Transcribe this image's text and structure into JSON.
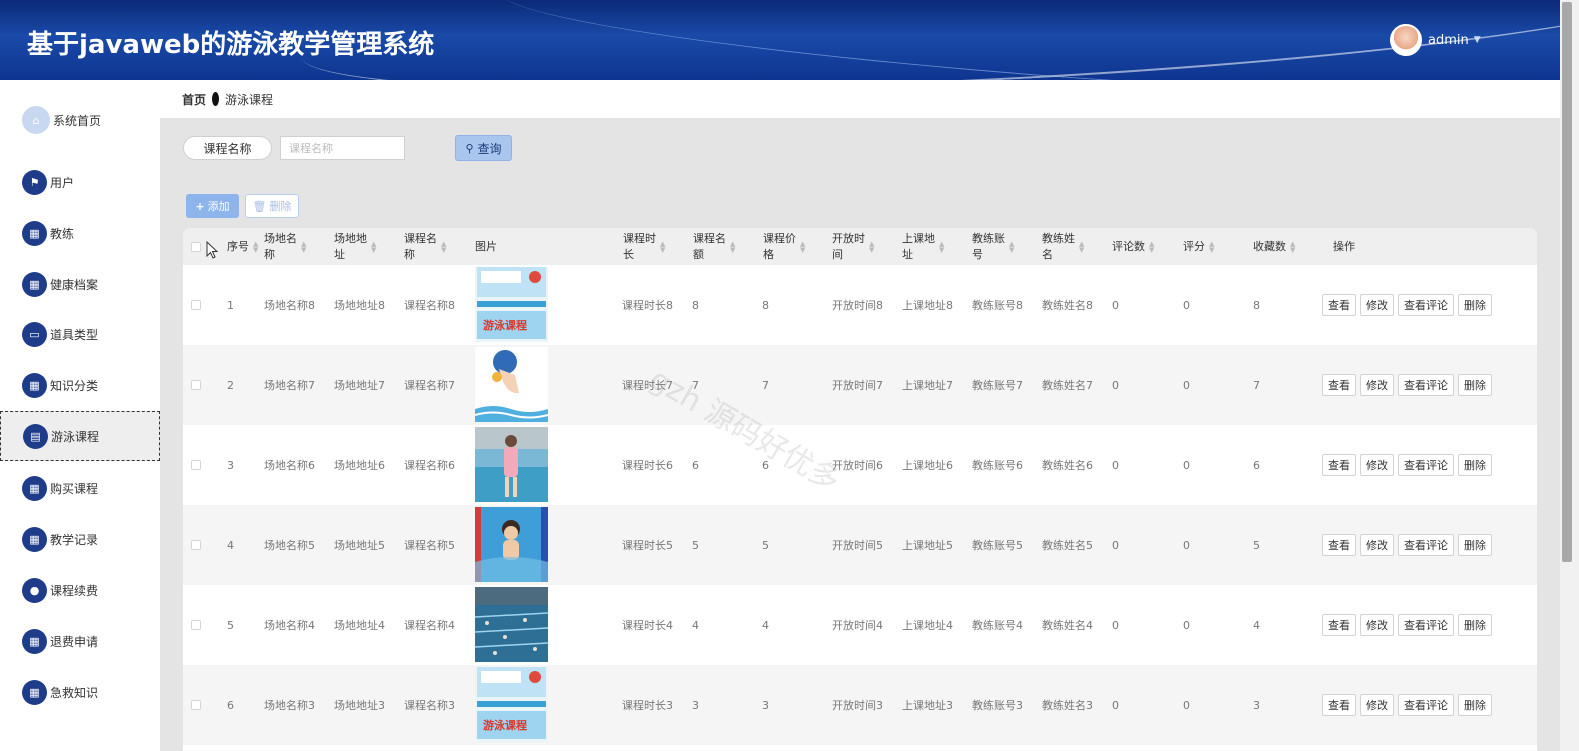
{
  "header": {
    "title": "基于javaweb的游泳教学管理系统",
    "username": "admin"
  },
  "breadcrumb": {
    "home": "首页",
    "current": "游泳课程"
  },
  "sidebar": {
    "items": [
      {
        "label": "系统首页",
        "icon": "home-icon"
      },
      {
        "label": "用户",
        "icon": "flag-icon"
      },
      {
        "label": "教练",
        "icon": "grid-icon"
      },
      {
        "label": "健康档案",
        "icon": "grid-icon"
      },
      {
        "label": "道具类型",
        "icon": "monitor-icon"
      },
      {
        "label": "知识分类",
        "icon": "grid-icon"
      },
      {
        "label": "游泳课程",
        "icon": "clipboard-icon",
        "active": true
      },
      {
        "label": "购买课程",
        "icon": "grid-icon"
      },
      {
        "label": "教学记录",
        "icon": "grid-icon"
      },
      {
        "label": "课程续费",
        "icon": "user-icon"
      },
      {
        "label": "退费申请",
        "icon": "grid-icon"
      },
      {
        "label": "急救知识",
        "icon": "grid-icon"
      }
    ]
  },
  "search": {
    "label": "课程名称",
    "placeholder": "课程名称",
    "value": "",
    "query_label": "查询"
  },
  "toolbar": {
    "add_label": "添加",
    "delete_label": "删除"
  },
  "table": {
    "columns": {
      "index": "序号",
      "venue_name": "场地名\n称",
      "venue_address": "场地地\n址",
      "course_name": "课程名\n称",
      "image": "图片",
      "duration": "课程时\n长",
      "quota": "课程名\n额",
      "price": "课程价\n格",
      "open_time": "开放时\n间",
      "class_address": "上课地\n址",
      "coach_account": "教练账\n号",
      "coach_name": "教练姓\n名",
      "comments": "评论数",
      "rating": "评分",
      "favorites": "收藏数",
      "actions": "操作"
    },
    "action_labels": {
      "view": "查看",
      "edit": "修改",
      "view_comments": "查看评论",
      "delete": "删除"
    },
    "rows": [
      {
        "index": "1",
        "venue_name": "场地名称8",
        "venue_address": "场地地址8",
        "course_name": "课程名称8",
        "image": "swim-poster",
        "duration": "课程时长8",
        "quota": "8",
        "price": "8",
        "open_time": "开放时间8",
        "class_address": "上课地址8",
        "coach_account": "教练账号8",
        "coach_name": "教练姓名8",
        "comments": "0",
        "rating": "0",
        "favorites": "8"
      },
      {
        "index": "2",
        "venue_name": "场地名称7",
        "venue_address": "场地地址7",
        "course_name": "课程名称7",
        "image": "swimmer-cartoon",
        "duration": "课程时长7",
        "quota": "7",
        "price": "7",
        "open_time": "开放时间7",
        "class_address": "上课地址7",
        "coach_account": "教练账号7",
        "coach_name": "教练姓名7",
        "comments": "0",
        "rating": "0",
        "favorites": "7"
      },
      {
        "index": "3",
        "venue_name": "场地名称6",
        "venue_address": "场地地址6",
        "course_name": "课程名称6",
        "image": "girl-poolside",
        "duration": "课程时长6",
        "quota": "6",
        "price": "6",
        "open_time": "开放时间6",
        "class_address": "上课地址6",
        "coach_account": "教练账号6",
        "coach_name": "教练姓名6",
        "comments": "0",
        "rating": "0",
        "favorites": "6"
      },
      {
        "index": "4",
        "venue_name": "场地名称5",
        "venue_address": "场地地址5",
        "course_name": "课程名称5",
        "image": "boy-in-pool",
        "duration": "课程时长5",
        "quota": "5",
        "price": "5",
        "open_time": "开放时间5",
        "class_address": "上课地址5",
        "coach_account": "教练账号5",
        "coach_name": "教练姓名5",
        "comments": "0",
        "rating": "0",
        "favorites": "5"
      },
      {
        "index": "5",
        "venue_name": "场地名称4",
        "venue_address": "场地地址4",
        "course_name": "课程名称4",
        "image": "pool-lanes",
        "duration": "课程时长4",
        "quota": "4",
        "price": "4",
        "open_time": "开放时间4",
        "class_address": "上课地址4",
        "coach_account": "教练账号4",
        "coach_name": "教练姓名4",
        "comments": "0",
        "rating": "0",
        "favorites": "4"
      },
      {
        "index": "6",
        "venue_name": "场地名称3",
        "venue_address": "场地地址3",
        "course_name": "课程名称3",
        "image": "swim-poster",
        "duration": "课程时长3",
        "quota": "3",
        "price": "3",
        "open_time": "开放时间3",
        "class_address": "上课地址3",
        "coach_account": "教练账号3",
        "coach_name": "教练姓名3",
        "comments": "0",
        "rating": "0",
        "favorites": "3"
      }
    ]
  },
  "watermark": "gzh 源码好优多",
  "colors": {
    "header_bg": "#0e3590",
    "nav_icon_bg": "#1f3c8a",
    "primary_button": "#8eb4ec",
    "main_bg": "#e4e4e4"
  }
}
